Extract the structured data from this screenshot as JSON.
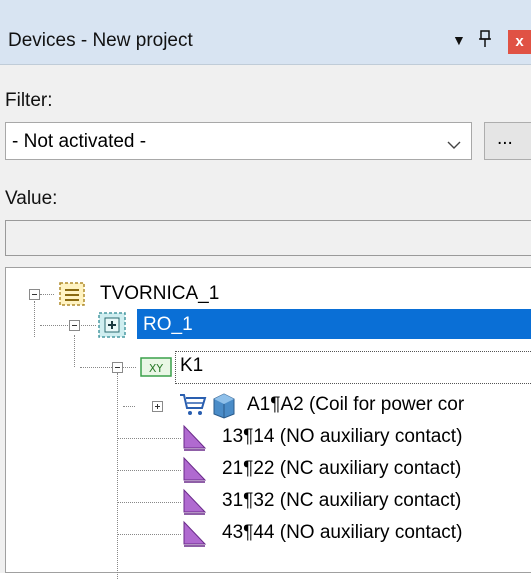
{
  "window": {
    "title": "Devices - New project",
    "dropdown_glyph": "▼",
    "pin_glyph": "ᵽ",
    "close_glyph": "x"
  },
  "filter": {
    "label": "Filter:",
    "selected": "- Not activated -",
    "more_button": "..."
  },
  "value": {
    "label": "Value:",
    "text": ""
  },
  "tree": {
    "nodes": [
      {
        "label": "TVORNICA_1",
        "icon": "location-box-icon",
        "expanded": true
      },
      {
        "label": "RO_1",
        "icon": "cabinet-plus-icon",
        "expanded": true,
        "selected": true
      },
      {
        "label": "K1",
        "icon": "xy-device-icon",
        "expanded": true
      },
      {
        "label": "A1¶A2 (Coil for power cor",
        "icon": "coil-icon",
        "expanded": false
      },
      {
        "label": "13¶14 (NO auxiliary contact)",
        "icon": "contact-icon"
      },
      {
        "label": "21¶22 (NC auxiliary contact)",
        "icon": "contact-icon"
      },
      {
        "label": "31¶32 (NC auxiliary contact)",
        "icon": "contact-icon"
      },
      {
        "label": "43¶44 (NO auxiliary contact)",
        "icon": "contact-icon"
      }
    ]
  },
  "colors": {
    "selection": "#0a6fd6",
    "title_bar": "#d8e4f2",
    "close_button": "#e05244"
  }
}
